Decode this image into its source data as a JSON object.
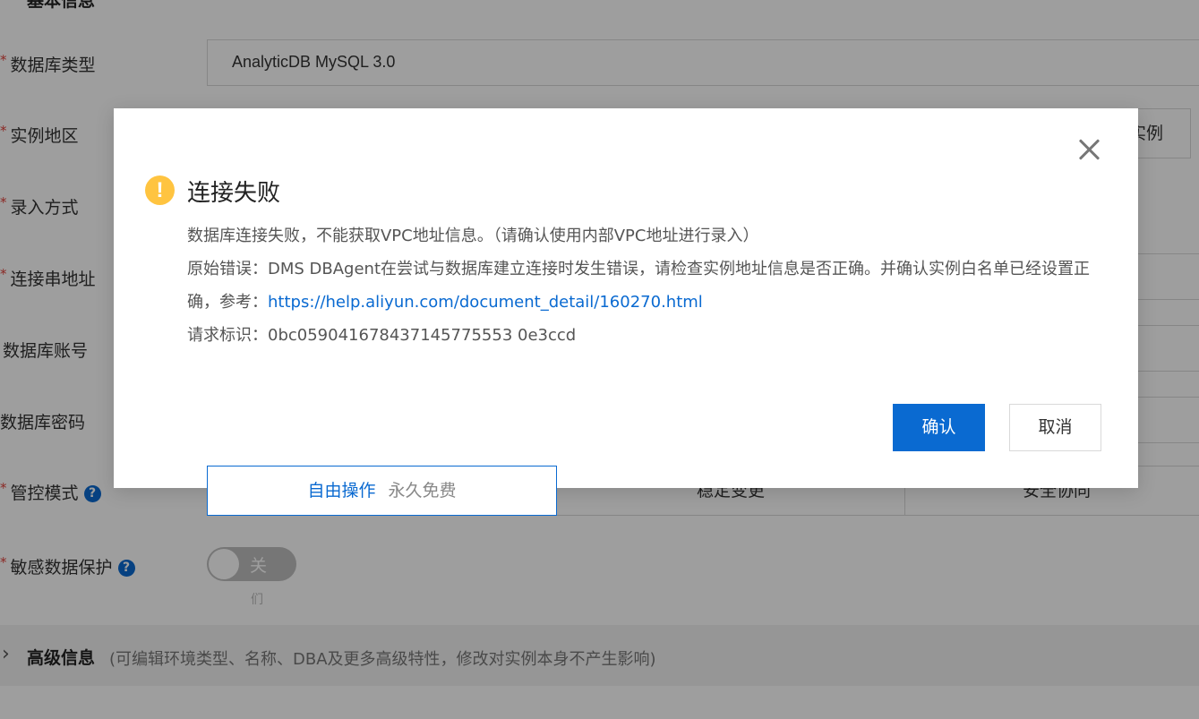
{
  "form": {
    "section_title": "基本信息",
    "db_type": {
      "label": "数据库类型",
      "value": "AnalyticDB MySQL 3.0"
    },
    "region": {
      "label": "实例地区",
      "button_label": "实例"
    },
    "entry_method": {
      "label": "录入方式"
    },
    "connection_address": {
      "label": "连接串地址"
    },
    "db_account": {
      "label": "数据库账号"
    },
    "db_password": {
      "label": "数据库密码"
    },
    "control_mode": {
      "label": "管控模式",
      "options": [
        {
          "label": "自由操作",
          "sub": "永久免费"
        },
        {
          "label": "稳定变更"
        },
        {
          "label": "安全协同"
        }
      ]
    },
    "sensitive_protection": {
      "label": "敏感数据保护",
      "toggle_text": "关",
      "toggle_sub": "们"
    },
    "advanced": {
      "title": "高级信息",
      "description": "(可编辑环境类型、名称、DBA及更多高级特性，修改对实例本身不产生影响)"
    }
  },
  "dialog": {
    "title": "连接失败",
    "message_line1": "数据库连接失败，不能获取VPC地址信息。（请确认使用内部VPC地址进行录入）",
    "error_text": "原始错误：DMS DBAgent在尝试与数据库建立连接时发生错误，请检查实例地址信息是否正确。并确认实例白名单已经设置正确，参考：",
    "error_link": "https://help.aliyun.com/document_detail/160270.html",
    "request_id_label": "请求标识：",
    "request_id": "0bc059041678437145775553 0e3ccd",
    "ok_label": "确认",
    "cancel_label": "取消"
  },
  "colors": {
    "primary": "#0a6ad1",
    "warning": "#ffc440",
    "required_star": "#e0413a"
  },
  "icons": {
    "warning": "exclamation-circle-icon",
    "close": "close-icon",
    "help": "question-circle-icon",
    "chevron": "chevron-right-icon"
  }
}
